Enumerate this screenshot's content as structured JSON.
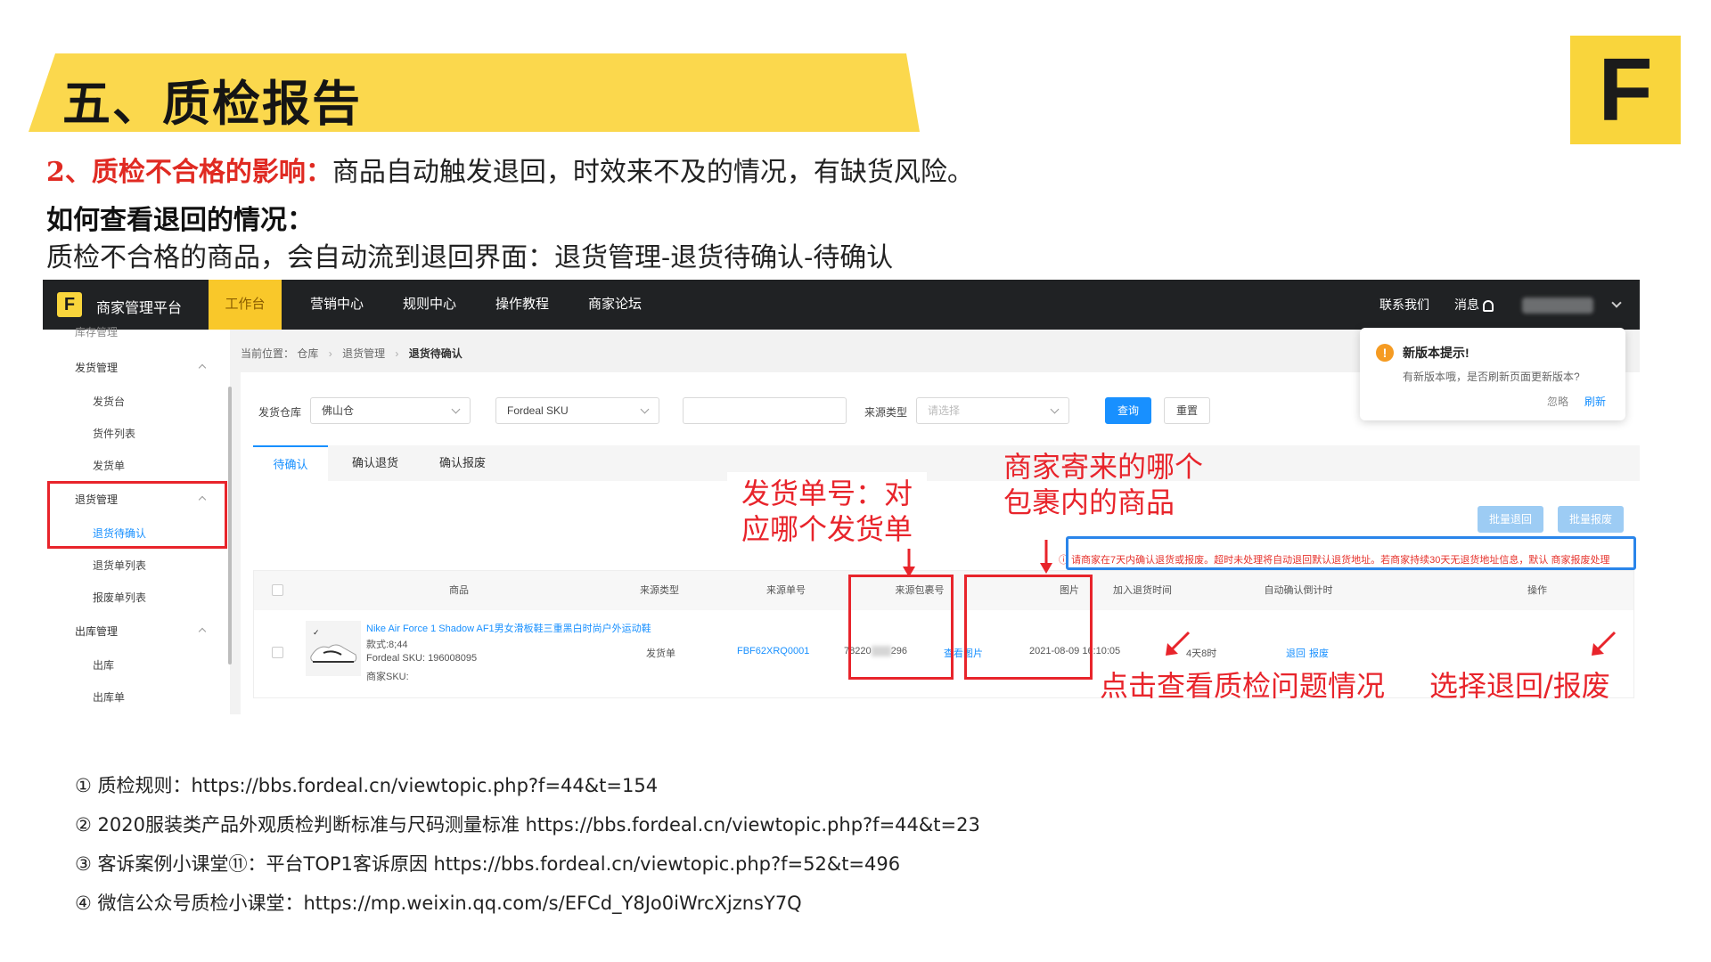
{
  "slide": {
    "title": "五、质检报告",
    "logo_letter": "F",
    "line1_prefix": "2、质检不合格的影响：",
    "line1_text": "商品自动触发退回，时效来不及的情况，有缺货风险。",
    "line2": "如何查看退回的情况：",
    "line3": "质检不合格的商品，会自动流到退回界面：退货管理-退货待确认-待确认"
  },
  "app": {
    "logo_letter": "F",
    "brand": "商家管理平台",
    "nav": [
      "工作台",
      "营销中心",
      "规则中心",
      "操作教程",
      "商家论坛"
    ],
    "nav_right": {
      "contact": "联系我们",
      "messages": "消息"
    },
    "sidebar": {
      "cut_item": "库存管理",
      "groups": [
        {
          "label": "发货管理",
          "items": [
            "发货台",
            "货件列表",
            "发货单"
          ]
        },
        {
          "label": "退货管理",
          "items": [
            "退货待确认",
            "退货单列表",
            "报废单列表"
          ]
        },
        {
          "label": "出库管理",
          "items": [
            "出库",
            "出库单"
          ]
        }
      ]
    },
    "breadcrumb": {
      "prefix": "当前位置：",
      "items": [
        "仓库",
        "退货管理",
        "退货待确认"
      ]
    },
    "filters": {
      "warehouse_label": "发货仓库",
      "warehouse_value": "佛山仓",
      "sku_select": "Fordeal SKU",
      "source_type_label": "来源类型",
      "source_type_placeholder": "请选择",
      "search_button": "查询",
      "reset_button": "重置"
    },
    "tabs": [
      "待确认",
      "确认退货",
      "确认报废"
    ],
    "batch_return": "批量退回",
    "batch_scrap": "批量报废",
    "warning": "请商家在7天内确认退货或报废。超时未处理将自动退回默认退货地址。若商家持续30天无退货地址信息，默认 商家报废处理",
    "table": {
      "columns": [
        "商品",
        "来源类型",
        "来源单号",
        "来源包裹号",
        "图片",
        "加入退货时间",
        "自动确认倒计时",
        "操作"
      ],
      "rows": [
        {
          "product_name": "Nike Air Force 1 Shadow AF1男女滑板鞋三重黑白时尚户外运动鞋",
          "style": "款式:8;44",
          "fordeal_sku": "Fordeal SKU: 196008095",
          "merchant_sku": "商家SKU:",
          "source_type": "发货单",
          "source_no": "FBF62XRQ0001",
          "package_no_prefix": "78220",
          "package_no_suffix": "296",
          "image_link": "查看图片",
          "added_time": "2021-08-09 16:10:05",
          "countdown": "4天8时",
          "action_return": "退回",
          "action_scrap": "报废"
        }
      ]
    },
    "popup": {
      "icon": "!",
      "title": "新版本提示!",
      "body": "有新版本哦，是否刷新页面更新版本?",
      "ignore": "忽略",
      "refresh": "刷新"
    }
  },
  "annotations": {
    "ship_order_line1": "发货单号：对",
    "ship_order_line2": "应哪个发货单",
    "package_line1": "商家寄来的哪个",
    "package_line2": "包裹内的商品",
    "view_images": "点击查看质检问题情况",
    "choose_action": "选择退回/报废"
  },
  "references": [
    "① 质检规则：https://bbs.fordeal.cn/viewtopic.php?f=44&t=154",
    "② 2020服装类产品外观质检判断标准与尺码测量标准 https://bbs.fordeal.cn/viewtopic.php?f=44&t=23",
    "③ 客诉案例小课堂⑪：平台TOP1客诉原因 https://bbs.fordeal.cn/viewtopic.php?f=52&t=496",
    "④ 微信公众号质检小课堂：https://mp.weixin.qq.com/s/EFCd_Y8Jo0iWrcXjznsY7Q"
  ],
  "colors": {
    "banner": "#fbd84d",
    "accent_red": "#e8242b",
    "link_blue": "#1890ff",
    "nav_bg": "#202224"
  }
}
